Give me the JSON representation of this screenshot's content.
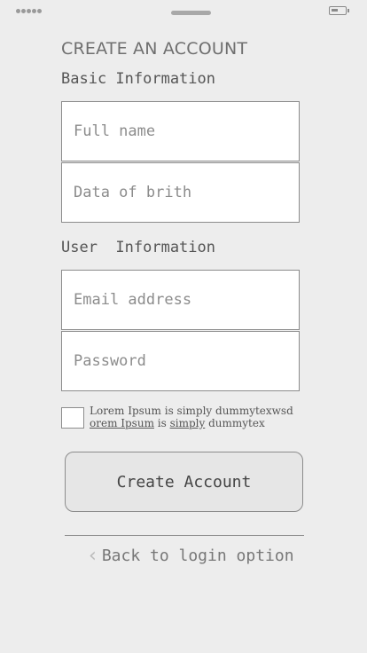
{
  "status_bar": {
    "signal_icon": "signal-dots-icon",
    "battery_icon": "battery-icon"
  },
  "page": {
    "title": "CREATE AN ACCOUNT"
  },
  "basic_info": {
    "heading": "Basic Information",
    "full_name_placeholder": "Full name",
    "dob_placeholder": "Data of brith"
  },
  "user_info": {
    "heading": "User  Information",
    "email_placeholder": "Email address",
    "password_placeholder": "Password"
  },
  "terms": {
    "line1": "Lorem Ipsum is simply dummytexwsd",
    "line2_a": "orem Ipsum",
    "line2_b": " is ",
    "line2_c": "simply",
    "line2_d": " dummytex"
  },
  "actions": {
    "create_label": "Create Account",
    "back_label": "Back to login option",
    "back_icon": "chevron-left-icon"
  }
}
